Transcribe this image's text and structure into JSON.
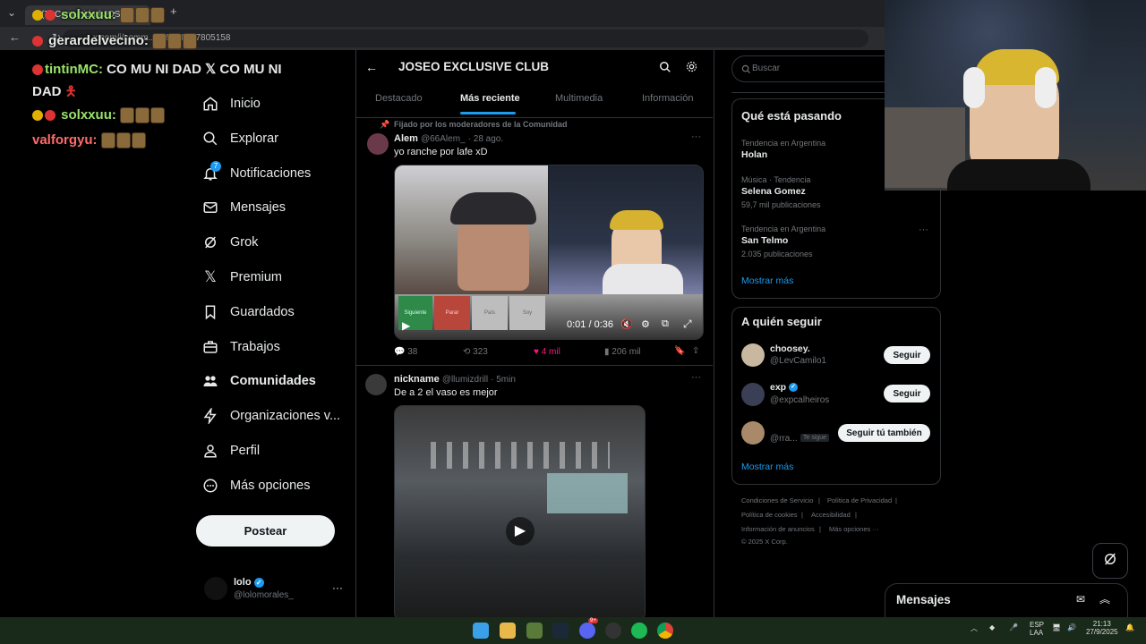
{
  "browser": {
    "tab_title": "(7) Comunidad JOSEO E",
    "url": "x.com/i/comm...039546407805158",
    "add_tab": "+"
  },
  "chat": [
    {
      "user": "solxxuu:",
      "text": ""
    },
    {
      "user": "gerardelvecino:",
      "text": ""
    },
    {
      "user": "tintinMC:",
      "text": "CO MU NI DAD",
      "tail": "CO MU NI",
      "line2": "DAD"
    },
    {
      "user": "solxxuu:",
      "text": ""
    },
    {
      "user": "valforgyu:",
      "text": ""
    }
  ],
  "nav": {
    "items": [
      {
        "label": "Inicio"
      },
      {
        "label": "Explorar"
      },
      {
        "label": "Notificaciones",
        "badge": "7"
      },
      {
        "label": "Mensajes"
      },
      {
        "label": "Grok"
      },
      {
        "label": "Premium"
      },
      {
        "label": "Guardados"
      },
      {
        "label": "Trabajos"
      },
      {
        "label": "Comunidades"
      },
      {
        "label": "Organizaciones v..."
      },
      {
        "label": "Perfil"
      },
      {
        "label": "Más opciones"
      }
    ],
    "post_label": "Postear",
    "account": {
      "name": "lolo",
      "handle": "@lolomorales_",
      "more": "···"
    }
  },
  "community": {
    "title": "JOSEO EXCLUSIVE CLUB",
    "tabs": [
      "Destacado",
      "Más reciente",
      "Multimedia",
      "Información"
    ],
    "active_tab": "Más reciente"
  },
  "tweets": [
    {
      "pinned_label": "Fijado por los moderadores de la Comunidad",
      "name": "Alem",
      "handle": "@66Alem_",
      "time": "· 28 ago.",
      "text": "yo ranche por lafe xD",
      "video_time": "0:01 / 0:36",
      "video_buttons": [
        "Siguiente",
        "Parar",
        "País",
        "Soy"
      ],
      "stats": {
        "replies": "38",
        "reposts": "323",
        "likes": "4 mil",
        "views": "206 mil"
      }
    },
    {
      "name": "nickname",
      "handle": "@llumizdrill",
      "time": "· 5min",
      "text": "De a 2 el vaso es mejor"
    }
  ],
  "right": {
    "search_placeholder": "Buscar",
    "trends_title": "Qué está pasando",
    "trends": [
      {
        "meta": "Tendencia en Argentina",
        "name": "Holan",
        "count": ""
      },
      {
        "meta": "Música · Tendencia",
        "name": "Selena Gomez",
        "count": "59,7 mil publicaciones"
      },
      {
        "meta": "Tendencia en Argentina",
        "name": "San Telmo",
        "count": "2.035 publicaciones"
      }
    ],
    "show_more": "Mostrar más",
    "follow_title": "A quién seguir",
    "follow": [
      {
        "name": "choosey.",
        "handle": "@LevCamilo1",
        "button": "Seguir"
      },
      {
        "name": "exp",
        "handle": "@expcalheiros",
        "button": "Seguir"
      },
      {
        "name": "",
        "handle": "@rra...",
        "tag": "Te sigue",
        "button": "Seguir tú también"
      }
    ],
    "footer": [
      "Condiciones de Servicio",
      "|",
      "Política de Privacidad",
      "|",
      "Política de cookies",
      "|",
      "Accesibilidad",
      "|",
      "Información de anuncios",
      "|",
      "Más opciones ···",
      "© 2025 X Corp."
    ],
    "messages_label": "Mensajes"
  },
  "taskbar": {
    "lang": "ESP",
    "lang2": "LAA",
    "time": "21:13",
    "date": "27/9/2025",
    "discord_badge": "9+"
  },
  "colors": {
    "accent": "#1d9bf0",
    "like": "#f91880",
    "chat_user": "#9be36a",
    "chat_red": "#ff6a6a"
  }
}
